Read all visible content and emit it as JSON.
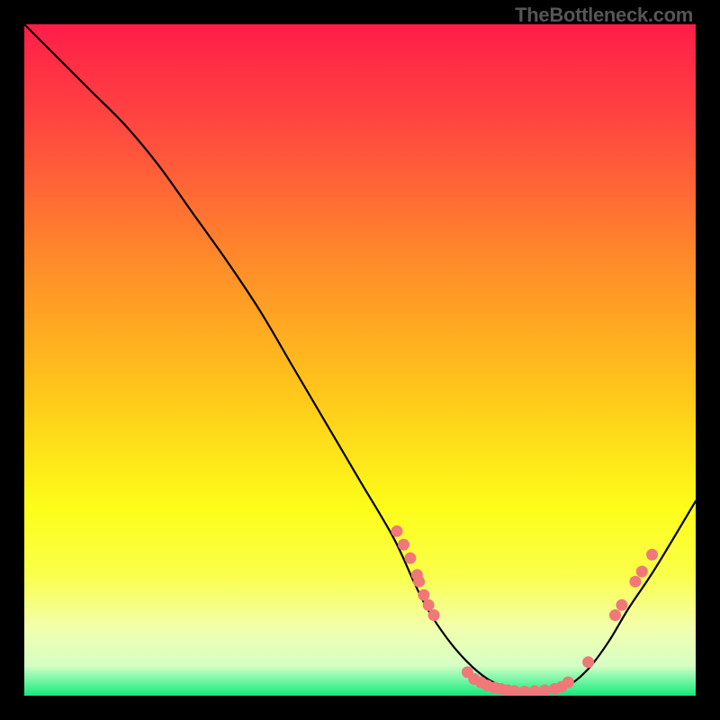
{
  "watermark": "TheBottleneck.com",
  "chart_data": {
    "type": "line",
    "title": "",
    "xlabel": "",
    "ylabel": "",
    "xlim": [
      0,
      100
    ],
    "ylim": [
      0,
      100
    ],
    "series": [
      {
        "name": "bottleneck-curve",
        "x": [
          0,
          5,
          10,
          15,
          20,
          25,
          30,
          35,
          40,
          45,
          50,
          55,
          58,
          60,
          63,
          66,
          69,
          72,
          75,
          78,
          81,
          84,
          87,
          90,
          94,
          100
        ],
        "y": [
          100,
          95,
          90,
          85,
          79,
          72,
          65,
          57.5,
          49,
          40.5,
          32,
          23.5,
          17,
          13,
          8.5,
          5,
          2.5,
          1.2,
          0.6,
          0.6,
          1.5,
          4,
          8,
          13,
          19,
          29
        ]
      }
    ],
    "scatter": {
      "name": "data-points",
      "color": "#f07878",
      "points": [
        {
          "x": 55.5,
          "y": 24.5
        },
        {
          "x": 56.5,
          "y": 22.5
        },
        {
          "x": 57.5,
          "y": 20.5
        },
        {
          "x": 58.5,
          "y": 18
        },
        {
          "x": 58.8,
          "y": 17
        },
        {
          "x": 59.5,
          "y": 15
        },
        {
          "x": 60.2,
          "y": 13.5
        },
        {
          "x": 61,
          "y": 12
        },
        {
          "x": 66,
          "y": 3.5
        },
        {
          "x": 67,
          "y": 2.5
        },
        {
          "x": 68,
          "y": 2
        },
        {
          "x": 69,
          "y": 1.5
        },
        {
          "x": 70,
          "y": 1.2
        },
        {
          "x": 71,
          "y": 1
        },
        {
          "x": 72,
          "y": 0.8
        },
        {
          "x": 73,
          "y": 0.7
        },
        {
          "x": 74.5,
          "y": 0.6
        },
        {
          "x": 76,
          "y": 0.7
        },
        {
          "x": 77.5,
          "y": 0.8
        },
        {
          "x": 79,
          "y": 1
        },
        {
          "x": 80,
          "y": 1.3
        },
        {
          "x": 81,
          "y": 2
        },
        {
          "x": 84,
          "y": 5
        },
        {
          "x": 88,
          "y": 12
        },
        {
          "x": 89,
          "y": 13.5
        },
        {
          "x": 91,
          "y": 17
        },
        {
          "x": 92,
          "y": 18.5
        },
        {
          "x": 93.5,
          "y": 21
        }
      ]
    },
    "gradient_stops": [
      {
        "offset": 0,
        "color": "#ff1d48"
      },
      {
        "offset": 0.15,
        "color": "#ff4740"
      },
      {
        "offset": 0.35,
        "color": "#ff8a2a"
      },
      {
        "offset": 0.55,
        "color": "#ffc71a"
      },
      {
        "offset": 0.72,
        "color": "#fdfd19"
      },
      {
        "offset": 0.82,
        "color": "#faff4a"
      },
      {
        "offset": 0.9,
        "color": "#f2ffae"
      },
      {
        "offset": 0.955,
        "color": "#d6ffc4"
      },
      {
        "offset": 0.975,
        "color": "#7cf7a8"
      },
      {
        "offset": 1.0,
        "color": "#14e879"
      }
    ]
  }
}
